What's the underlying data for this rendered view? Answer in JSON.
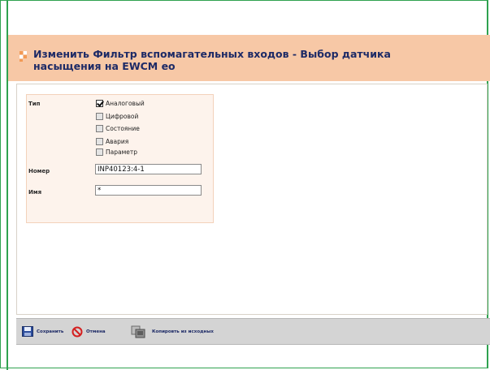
{
  "header": {
    "title": "Изменить Фильтр вспомагательных входов - Выбор датчика насыщения на EWCM eo"
  },
  "form": {
    "type_label": "Тип",
    "type_options": [
      {
        "label": "Аналоговый",
        "checked": true
      },
      {
        "label": "Цифровой",
        "checked": false
      },
      {
        "label": "Состояние",
        "checked": false
      },
      {
        "label": "Авария",
        "checked": false
      },
      {
        "label": "Параметр",
        "checked": false
      }
    ],
    "number_label": "Номер",
    "number_value": "INP40123:4-1",
    "name_label": "Имя",
    "name_value": "*"
  },
  "toolbar": {
    "save_label": "Сохранить",
    "cancel_label": "Отмена",
    "copy_label": "Копировть из исходных"
  },
  "colors": {
    "header_bg": "#f7c8a6",
    "title_text": "#1d2a66",
    "frame_border": "#2fa24f",
    "panel_bg": "#fdf3ec",
    "toolbar_bg": "#d4d4d4"
  }
}
